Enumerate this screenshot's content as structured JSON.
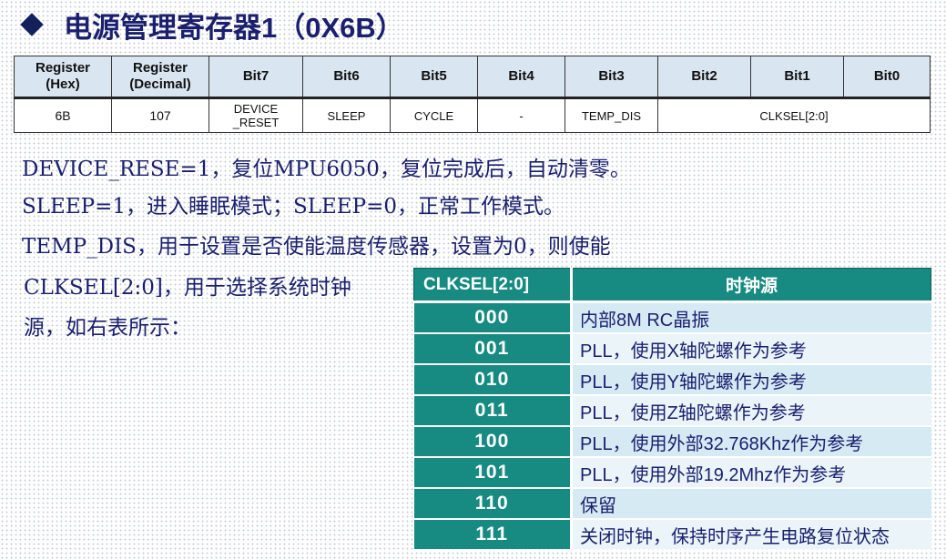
{
  "title": "电源管理寄存器1（0X6B）",
  "register_table": {
    "headers": [
      "Register\n(Hex)",
      "Register\n(Decimal)",
      "Bit7",
      "Bit6",
      "Bit5",
      "Bit4",
      "Bit3",
      "Bit2",
      "Bit1",
      "Bit0"
    ],
    "row": {
      "hex": "6B",
      "decimal": "107",
      "bit7": "DEVICE\n_RESET",
      "bit6": "SLEEP",
      "bit5": "CYCLE",
      "bit4": "-",
      "bit3": "TEMP_DIS",
      "bit2_0": "CLKSEL[2:0]"
    }
  },
  "paragraphs": [
    "DEVICE_RESE=1，复位MPU6050，复位完成后，自动清零。",
    "SLEEP=1，进入睡眠模式；SLEEP=0，正常工作模式。",
    "TEMP_DIS，用于设置是否使能温度传感器，设置为0，则使能",
    "CLKSEL[2:0]，用于选择系统时钟",
    "源，如右表所示："
  ],
  "clk_table": {
    "header_code": "CLKSEL[2:0]",
    "header_source": "时钟源",
    "rows": [
      {
        "code": "000",
        "source": "内部8M RC晶振"
      },
      {
        "code": "001",
        "source": "PLL，使用X轴陀螺作为参考"
      },
      {
        "code": "010",
        "source": "PLL，使用Y轴陀螺作为参考"
      },
      {
        "code": "011",
        "source": "PLL，使用Z轴陀螺作为参考"
      },
      {
        "code": "100",
        "source": "PLL，使用外部32.768Khz作为参考"
      },
      {
        "code": "101",
        "source": "PLL，使用外部19.2Mhz作为参考"
      },
      {
        "code": "110",
        "source": "保留"
      },
      {
        "code": "111",
        "source": "关闭时钟，保持时序产生电路复位状态"
      }
    ]
  },
  "colors": {
    "title": "#1a1f6e",
    "table_teal": "#178a82",
    "row_light_blue": "#d6eaf4",
    "header_blue": "#d9e5f1"
  }
}
